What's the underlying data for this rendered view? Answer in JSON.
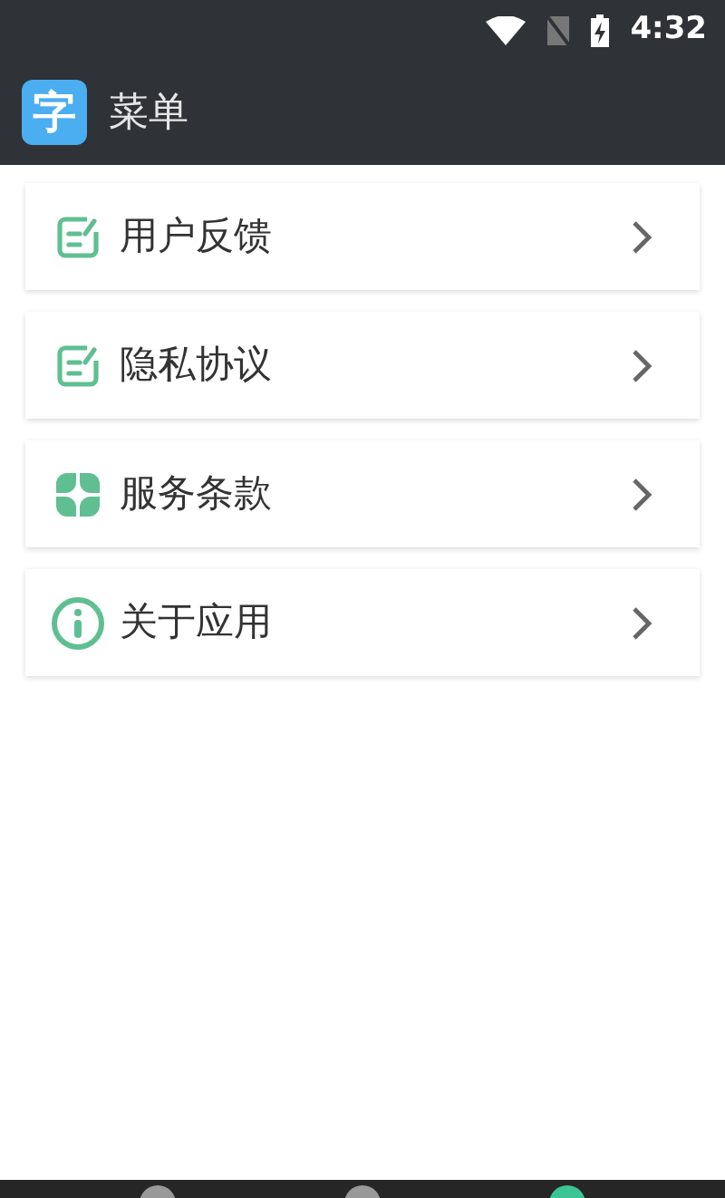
{
  "status_bar": {
    "time": "4:32"
  },
  "app_bar": {
    "logo": "字",
    "title": "菜单"
  },
  "menu": [
    {
      "kind": "edit",
      "label": "用户反馈"
    },
    {
      "kind": "edit",
      "label": "隐私协议"
    },
    {
      "kind": "grid",
      "label": "服务条款"
    },
    {
      "kind": "info",
      "label": "关于应用"
    }
  ],
  "bottom_nav": [
    {
      "selected": false
    },
    {
      "selected": false
    },
    {
      "selected": true
    }
  ]
}
